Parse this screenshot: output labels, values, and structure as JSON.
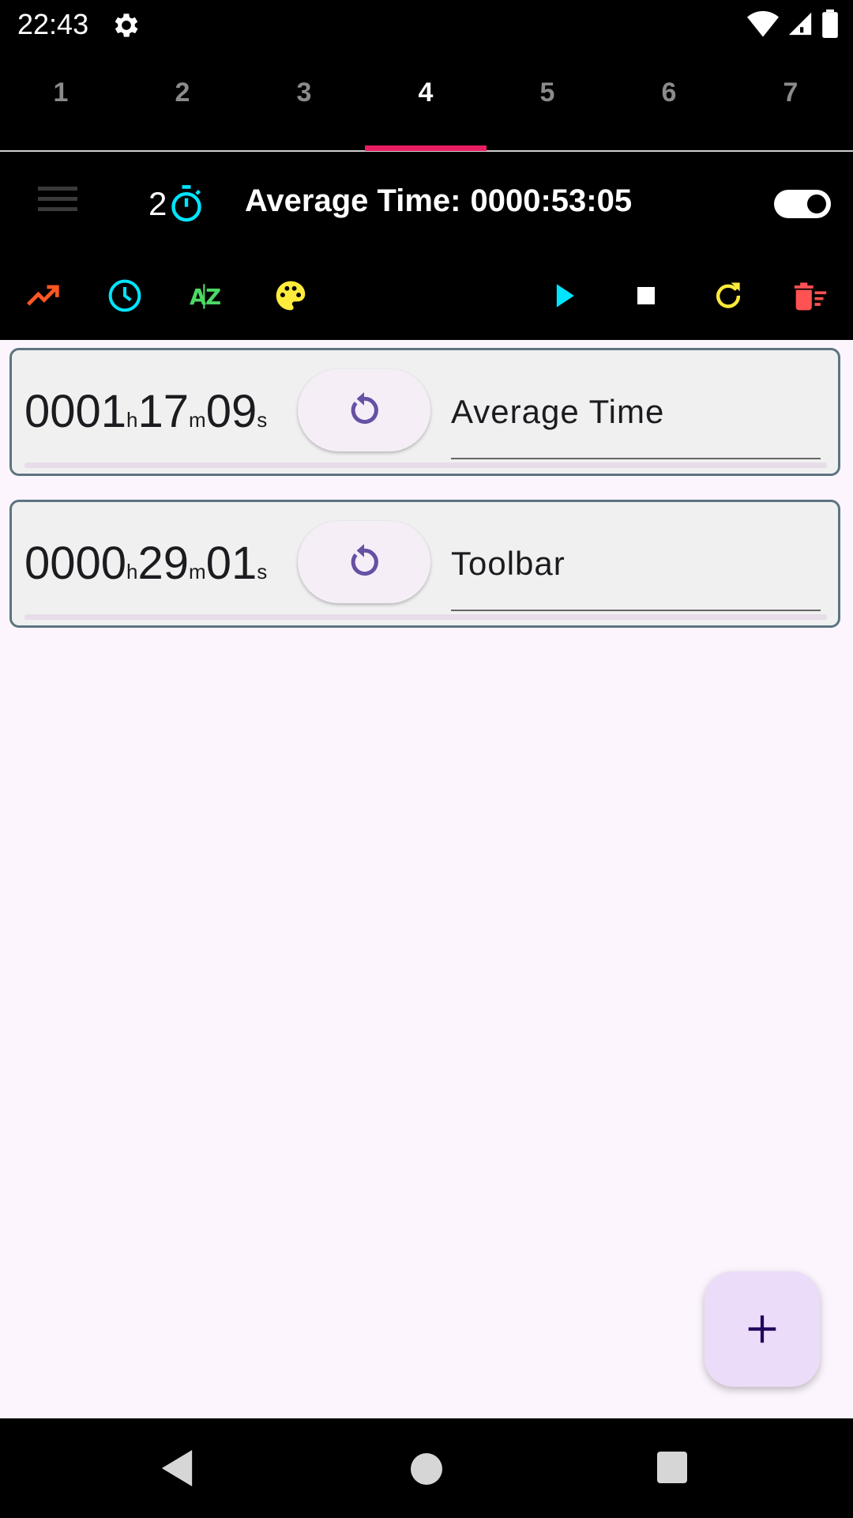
{
  "status_bar": {
    "time": "22:43"
  },
  "tabs": [
    "1",
    "2",
    "3",
    "4",
    "5",
    "6",
    "7"
  ],
  "active_tab": "4",
  "header": {
    "timer_count": "2",
    "average_label": "Average Time:",
    "average_value": "0000:53:05",
    "toggle_on": true
  },
  "toolbar": {
    "left_icons": [
      "trending-up-icon",
      "clock-icon",
      "sort-az-icon",
      "palette-icon"
    ],
    "right_icons": [
      "play-icon",
      "stop-icon",
      "refresh-icon",
      "delete-sweep-icon"
    ],
    "colors": {
      "trending": "#ff5722",
      "clock": "#00e5ff",
      "sort": "#4cd964",
      "palette": "#ffeb3b",
      "play": "#00e5ff",
      "stop": "#ffffff",
      "refresh": "#ffeb3b",
      "delete": "#ff5252"
    }
  },
  "timers": [
    {
      "hours": "0001",
      "h_unit": "h",
      "minutes": "17",
      "m_unit": "m",
      "seconds": "09",
      "s_unit": "s",
      "name": "Average Time"
    },
    {
      "hours": "0000",
      "h_unit": "h",
      "minutes": "29",
      "m_unit": "m",
      "seconds": "01",
      "s_unit": "s",
      "name": "Toolbar"
    }
  ],
  "fab": {
    "icon": "plus-icon"
  }
}
